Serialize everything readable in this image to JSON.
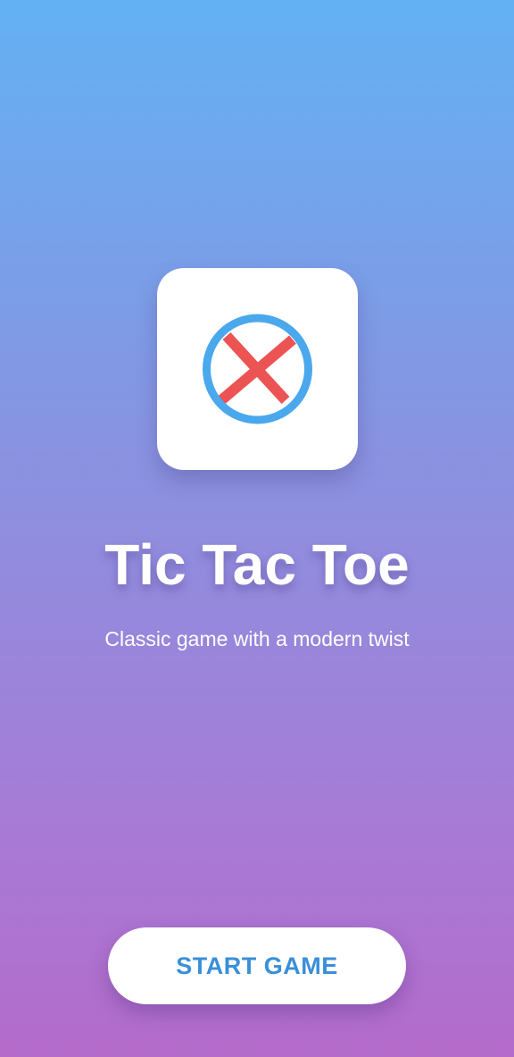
{
  "app": {
    "title": "Tic Tac Toe",
    "subtitle": "Classic game with a modern twist"
  },
  "logo": {
    "icon": "x-in-circle-icon",
    "ring_color": "#4aa8ec",
    "cross_color": "#ec5353"
  },
  "actions": {
    "start_label": "START GAME"
  },
  "colors": {
    "gradient_top": "#63b1f3",
    "gradient_bottom": "#b46bca",
    "button_text": "#3a8fd9"
  }
}
